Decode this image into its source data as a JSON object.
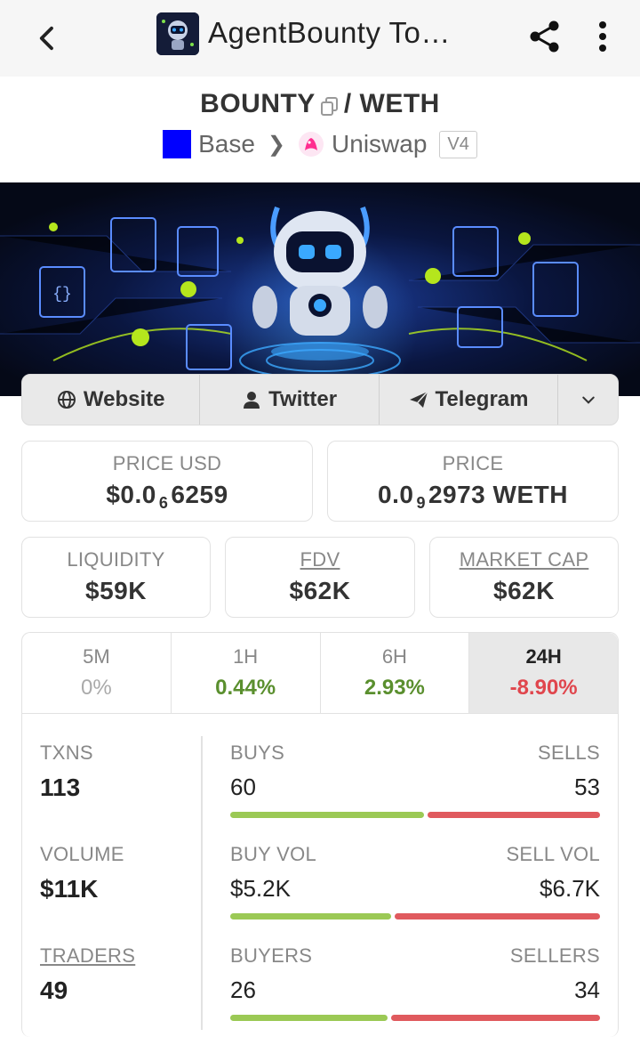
{
  "header": {
    "title": "AgentBounty To…"
  },
  "pair": {
    "base": "BOUNTY",
    "separator": "/",
    "quote": "WETH",
    "chain": "Base",
    "dex": "Uniswap",
    "version": "V4"
  },
  "links": {
    "website": "Website",
    "twitter": "Twitter",
    "telegram": "Telegram"
  },
  "price": {
    "usd_label": "PRICE USD",
    "usd_prefix": "$0.0",
    "usd_zeros": "6",
    "usd_digits": "6259",
    "native_label": "PRICE",
    "native_prefix": "0.0",
    "native_zeros": "9",
    "native_digits": "2973 WETH"
  },
  "metrics": {
    "liquidity_label": "LIQUIDITY",
    "liquidity": "$59K",
    "fdv_label": "FDV",
    "fdv": "$62K",
    "mcap_label": "MARKET CAP",
    "mcap": "$62K"
  },
  "timeframes": [
    {
      "label": "5M",
      "change": "0%"
    },
    {
      "label": "1H",
      "change": "0.44%"
    },
    {
      "label": "6H",
      "change": "2.93%"
    },
    {
      "label": "24H",
      "change": "-8.90%"
    }
  ],
  "stats": {
    "txns_label": "TXNS",
    "txns": "113",
    "volume_label": "VOLUME",
    "volume": "$11K",
    "traders_label": "TRADERS",
    "traders": "49",
    "buys_label": "BUYS",
    "buys": "60",
    "sells_label": "SELLS",
    "sells": "53",
    "buyvol_label": "BUY VOL",
    "buyvol": "$5.2K",
    "sellvol_label": "SELL VOL",
    "sellvol": "$6.7K",
    "buyers_label": "BUYERS",
    "buyers": "26",
    "sellers_label": "SELLERS",
    "sellers": "34"
  },
  "bars": {
    "buys_share": 0.53,
    "buyvol_share": 0.44,
    "buyers_share": 0.43
  },
  "colors": {
    "positive": "#5a8f2e",
    "negative": "#e0464d",
    "chain_base": "#0000ff",
    "bar_green": "#9bc955",
    "bar_red": "#e05a5e"
  }
}
